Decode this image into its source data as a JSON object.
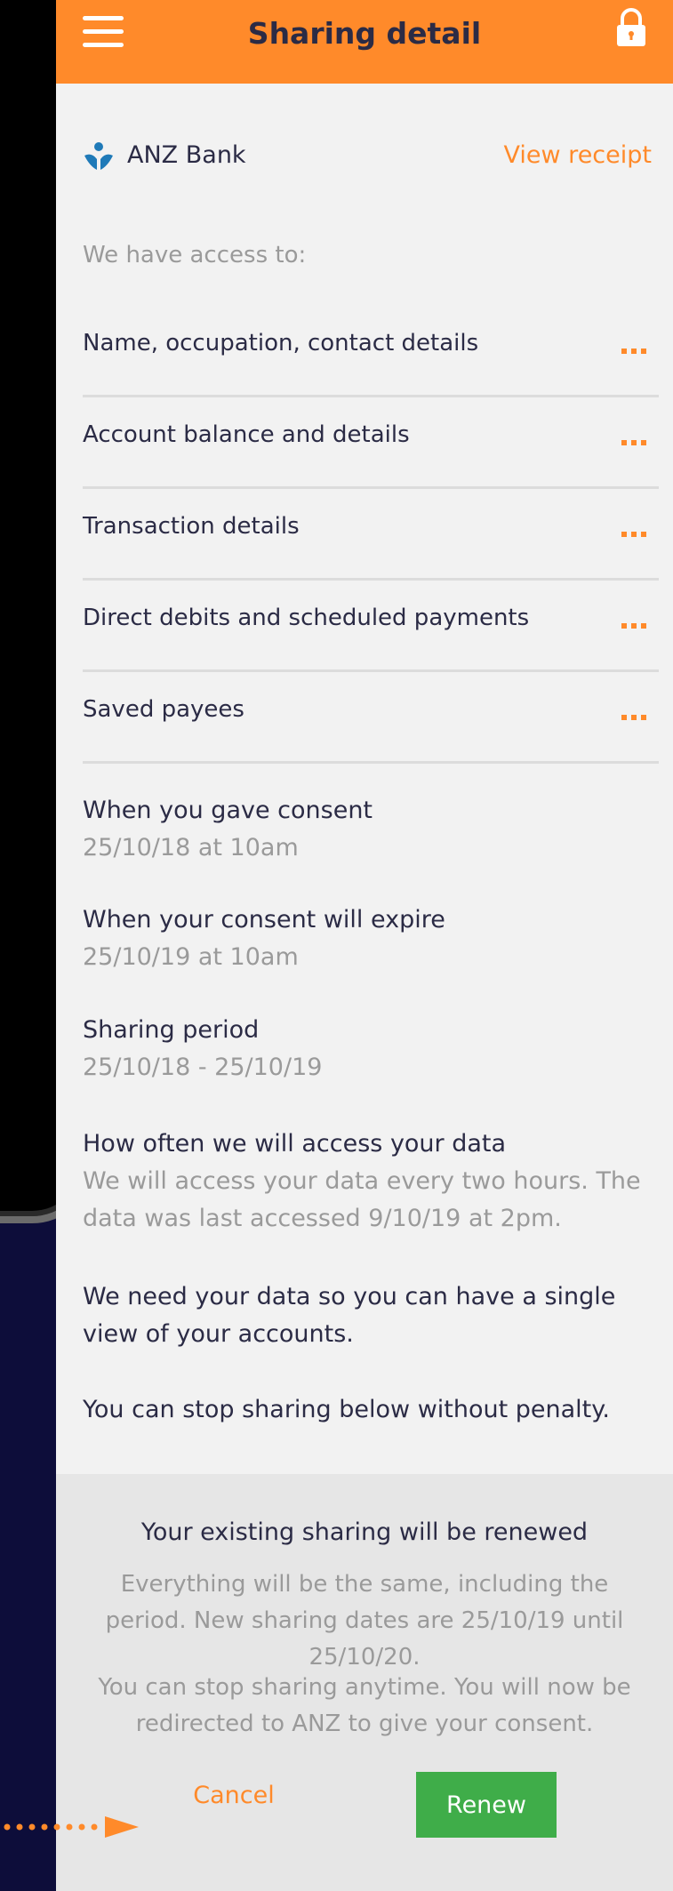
{
  "header": {
    "title": "Sharing detail",
    "color": "#ff8a2a"
  },
  "bank": {
    "name": "ANZ Bank",
    "view_receipt_label": "View receipt"
  },
  "access": {
    "label": "We have access to:",
    "items": [
      {
        "label": "Name, occupation, contact details"
      },
      {
        "label": "Account balance and details"
      },
      {
        "label": "Transaction details"
      },
      {
        "label": "Direct debits and scheduled payments"
      },
      {
        "label": "Saved payees"
      }
    ]
  },
  "consent": {
    "gave_title": "When you gave consent",
    "gave_value": "25/10/18 at 10am",
    "expire_title": "When your consent will expire",
    "expire_value": "25/10/19 at 10am",
    "period_title": "Sharing period",
    "period_value": "25/10/18 - 25/10/19",
    "frequency_title": "How often we will access your data",
    "frequency_value": "We will access your data every two hours. The data was last accessed 9/10/19 at 2pm."
  },
  "notes": {
    "need_data": "We need your data so you can have a single view of your accounts.",
    "stop_sharing": "You can stop sharing below without penalty."
  },
  "renew": {
    "title": "Your existing sharing will be renewed",
    "text1": "Everything will be the same, including the period. New sharing dates are 25/10/19 until 25/10/20.",
    "text2": "You can stop sharing anytime. You will now be redirected to ANZ to give your consent.",
    "cancel_label": "Cancel",
    "renew_label": "Renew",
    "renew_color": "#3fad49"
  }
}
